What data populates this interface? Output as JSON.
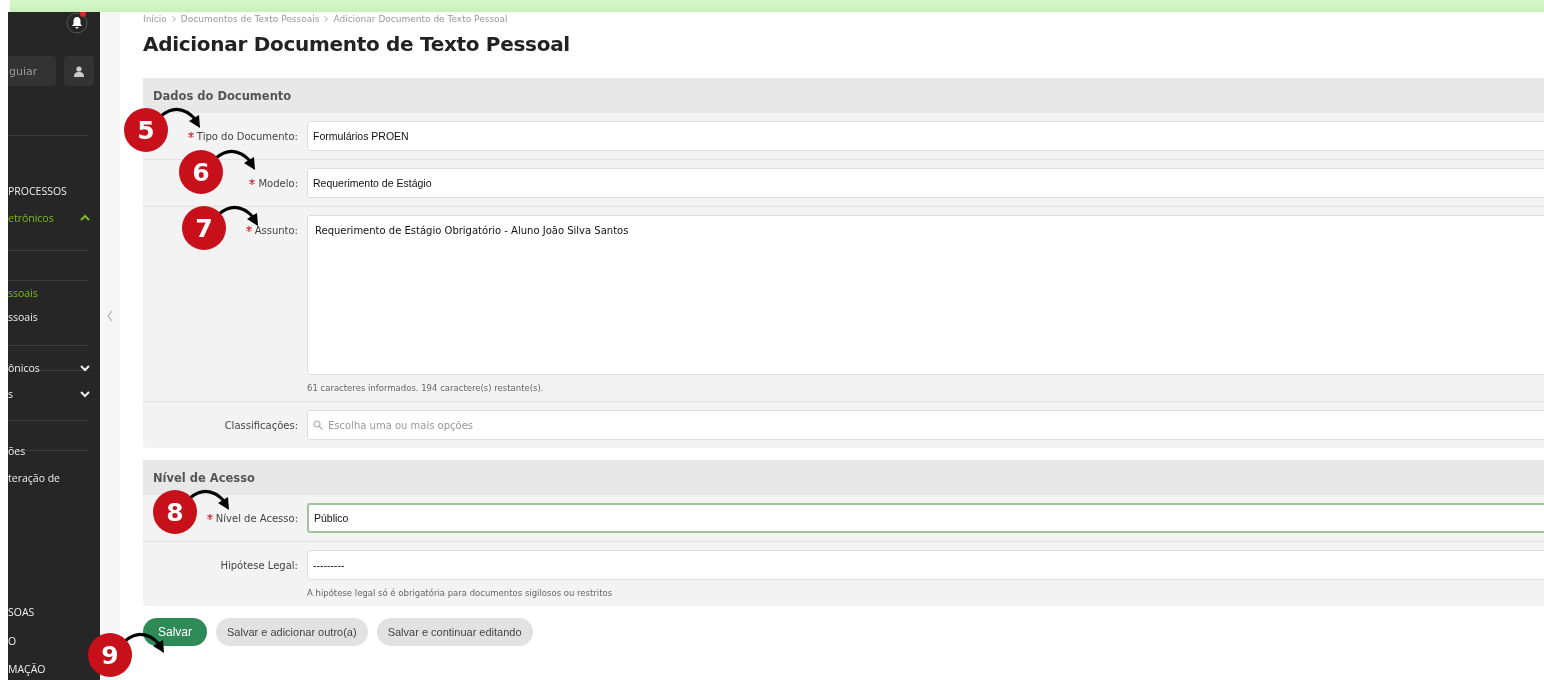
{
  "sidebar": {
    "search_button": "guiar",
    "items": [
      {
        "label": "PROCESSOS",
        "active": false
      },
      {
        "label": "etrônicos",
        "active": true,
        "expanded": true
      },
      {
        "label": "ssoais",
        "active": true
      },
      {
        "label": "ssoais",
        "active": false
      },
      {
        "label": "ônicos",
        "active": false,
        "expanded": false
      },
      {
        "label": "s",
        "active": false,
        "expanded": false
      },
      {
        "label": "ões",
        "active": false
      },
      {
        "label": "teração de",
        "active": false
      },
      {
        "label": "SOAS",
        "active": false
      },
      {
        "label": "O",
        "active": false
      },
      {
        "label": "MAÇÃO",
        "active": false
      }
    ]
  },
  "breadcrumb": [
    "Início",
    "Documentos de Texto Pessoais",
    "Adicionar Documento de Texto Pessoal"
  ],
  "title": "Adicionar Documento de Texto Pessoal",
  "fieldsets": [
    {
      "legend": "Dados do Documento",
      "fields": [
        {
          "label": "Tipo do Documento:",
          "required": true,
          "kind": "select",
          "value": "Formulários PROEN",
          "focused": false
        },
        {
          "label": "Modelo:",
          "required": true,
          "kind": "select",
          "value": "Requerimento de Estágio",
          "focused": false
        },
        {
          "label": "Assunto:",
          "required": true,
          "kind": "textarea",
          "value": "Requerimento de Estágio Obrigatório - Aluno João Silva Santos",
          "help": "61 caracteres informados. 194 caractere(s) restante(s).",
          "focused": false
        },
        {
          "label": "Classificações:",
          "required": false,
          "kind": "multiselect",
          "placeholder": "Escolha uma ou mais opções",
          "focused": false
        }
      ]
    },
    {
      "legend": "Nível de Acesso",
      "fields": [
        {
          "label": "Nível de Acesso:",
          "required": true,
          "kind": "select",
          "value": "Público",
          "focused": true
        },
        {
          "label": "Hipótese Legal:",
          "required": false,
          "kind": "select",
          "value": "---------",
          "help": "A hipótese legal só é obrigatória para documentos sigilosos ou restritos",
          "focused": false
        }
      ]
    }
  ],
  "buttons": [
    {
      "label": "Salvar",
      "kind": "primary"
    },
    {
      "label": "Salvar e adicionar outro(a)",
      "kind": "secondary"
    },
    {
      "label": "Salvar e continuar editando",
      "kind": "secondary"
    }
  ],
  "annotations": [
    "5",
    "6",
    "7",
    "8",
    "9"
  ]
}
